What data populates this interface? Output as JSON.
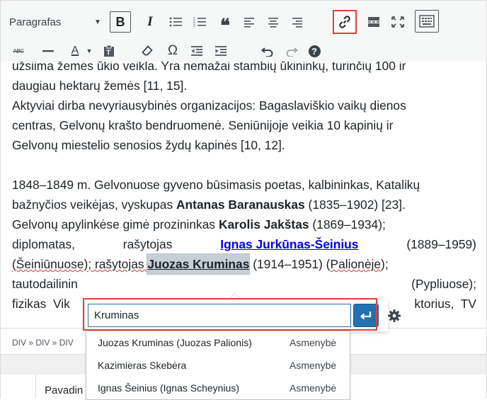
{
  "toolbar": {
    "format_select": "Paragrafas",
    "row1_icons": [
      "bold-icon",
      "italic-icon",
      "bullet-list-icon",
      "numbered-list-icon",
      "blockquote-icon",
      "align-left-icon",
      "align-center-icon",
      "align-right-icon",
      "link-icon",
      "read-more-icon",
      "fullscreen-icon",
      "toolbar-toggle-icon"
    ],
    "row2_icons": [
      "strikethrough-icon",
      "horizontal-line-icon",
      "text-color-icon",
      "paste-text-icon",
      "clear-formatting-icon",
      "special-character-icon",
      "outdent-icon",
      "indent-icon",
      "undo-icon",
      "redo-icon",
      "help-icon"
    ],
    "bold_label": "B",
    "italic_label": "I",
    "text_color_label": "A",
    "strike_label": "ABC",
    "special_char_label": "Ω",
    "help_label": "?",
    "active_icon": "link-icon",
    "highlight_color": "#e0403a"
  },
  "content": {
    "line1": "užsiima žemės ūkio veikla. Yra nemažai stambių ūkininkų, turinčių 100 ir",
    "line2": "daugiau hektarų žemės [11, 15].",
    "line3": "Aktyviai dirba nevyriausybinės organizacijos: Bagaslaviškio vaikų dienos",
    "line4": "centras, Gelvonų krašto bendruomenė. Seniūnijoje veikia 10 kapinių ir",
    "line5": "Gelvonų miestelio senosios žydų kapinės [10, 12].",
    "line6": "1848–1849 m. Gelvonuose gyveno būsimasis poetas, kalbininkas, Katalikų",
    "line7a": "bažnyčios veikėjas, vyskupas ",
    "line7b": "Antanas Baranauskas",
    "line7c": " (1835–1902) [23].",
    "line8a": "Gelvonų apylinkėse gimė prozininkas ",
    "line8b": "Karolis Jakštas",
    "line8c": " (1869–1934);",
    "line9a": "diplomatas,",
    "line9b": "rašytojas",
    "line9c": "Ignas Jurkūnas-Šeinius",
    "line9d": "(1889–1959)",
    "line10a": "(Šeiniūnuose); rašytojas ",
    "line10b": "Juozas Kruminas",
    "line10c": " (1914–1951) (",
    "line10d": "Palionėje",
    "line10e": ");",
    "line11a": "tautodailinin",
    "line11b": "(Pypliuose);",
    "line12a": "fizikas  Vik",
    "line12b": "ktorius,  TV"
  },
  "statusbar": {
    "path": "DIV » DIV » DIV"
  },
  "bottom": {
    "column_label": "Pavadin"
  },
  "link_popup": {
    "input_value": "Kruminas",
    "apply_icon": "return-arrow-icon",
    "settings_icon": "gear-icon",
    "accent": "#2271b1"
  },
  "suggestions": [
    {
      "name": "Juozas Kruminas (Juozas Palionis)",
      "type": "Asmenybė"
    },
    {
      "name": "Kazimieras Skebėra",
      "type": "Asmenybė"
    },
    {
      "name": "Ignas Šeinius (Ignas Scheynius)",
      "type": "Asmenybė"
    }
  ]
}
